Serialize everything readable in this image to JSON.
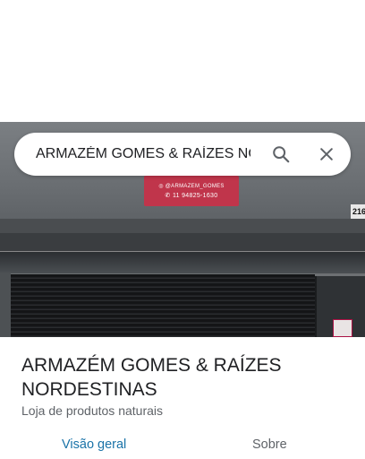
{
  "search": {
    "value": "ARMAZÉM GOMES & RAÍZES NORDESTINAS",
    "search_icon": "search-icon",
    "close_icon": "close-icon"
  },
  "photo": {
    "sign_line1": "◎ @ARMAZEM_GOMES",
    "sign_line2": "✆ 11 94825-1630",
    "number_plate": "216"
  },
  "place": {
    "name": "ARMAZÉM GOMES & RAÍZES NORDESTINAS",
    "category": "Loja de produtos naturais"
  },
  "tabs": [
    {
      "label": "Visão geral",
      "active": true
    },
    {
      "label": "Sobre",
      "active": false
    }
  ],
  "colors": {
    "active_tab": "#1a73a8",
    "sign": "#c0354b"
  }
}
